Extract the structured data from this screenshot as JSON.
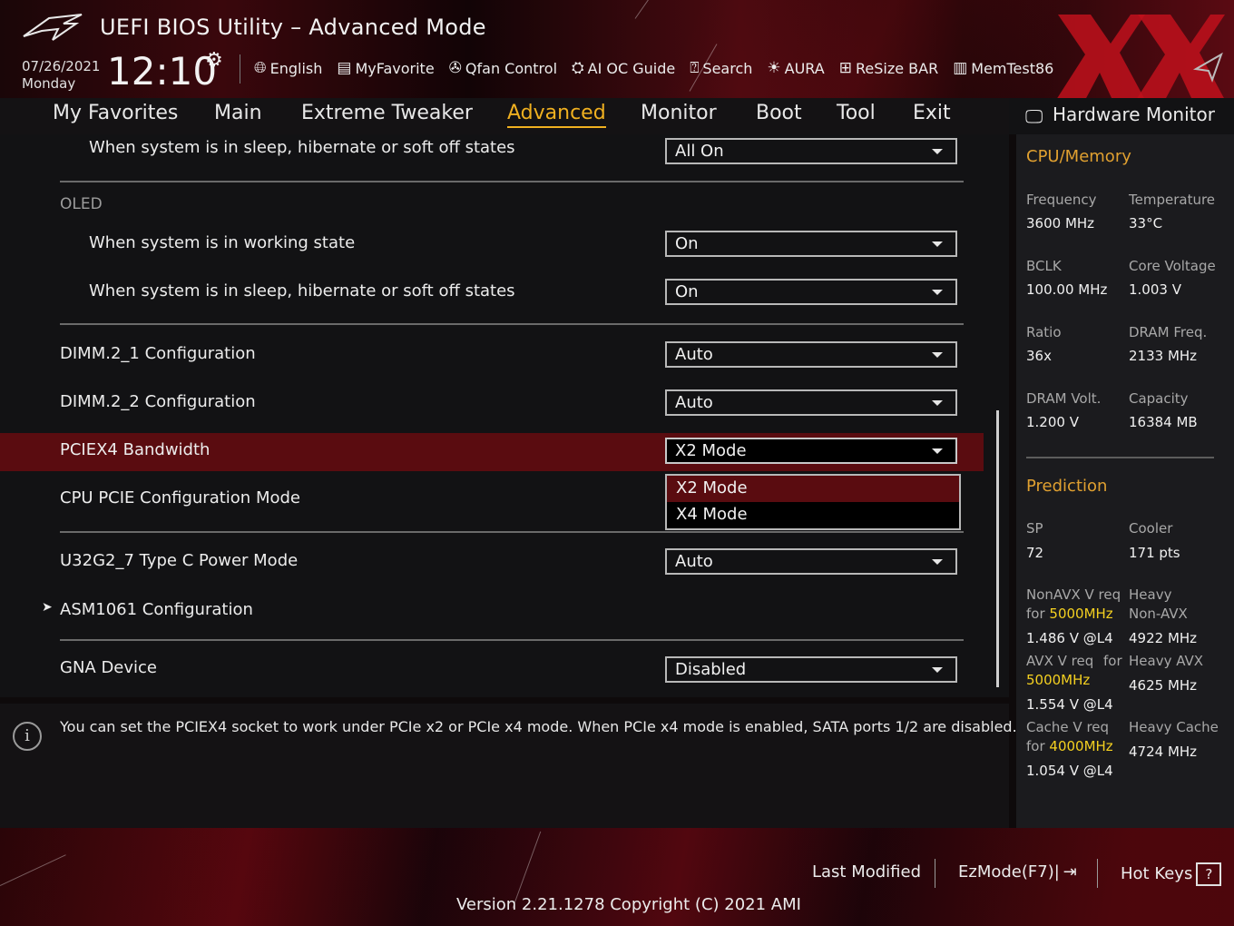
{
  "header": {
    "title": "UEFI BIOS Utility – Advanced Mode",
    "date": "07/26/2021",
    "day": "Monday",
    "time": "12:10"
  },
  "toolbar": [
    {
      "icon": "globe-icon",
      "label": "English"
    },
    {
      "icon": "favorite-icon",
      "label": "MyFavorite"
    },
    {
      "icon": "fan-icon",
      "label": "Qfan Control"
    },
    {
      "icon": "ai-chip-icon",
      "label": "AI OC Guide"
    },
    {
      "icon": "search-icon",
      "label": "Search"
    },
    {
      "icon": "aura-light-icon",
      "label": "AURA"
    },
    {
      "icon": "resize-bar-icon",
      "label": "ReSize BAR"
    },
    {
      "icon": "memory-icon",
      "label": "MemTest86"
    }
  ],
  "tabs": [
    "My Favorites",
    "Main",
    "Extreme Tweaker",
    "Advanced",
    "Monitor",
    "Boot",
    "Tool",
    "Exit"
  ],
  "active_tab": "Advanced",
  "settings": {
    "sleep_all": {
      "label": "When system is in sleep, hibernate or soft off states",
      "value": "All On"
    },
    "oled_section": "OLED",
    "oled_working": {
      "label": "When system is in working state",
      "value": "On"
    },
    "oled_sleep": {
      "label": "When system is in sleep, hibernate or soft off states",
      "value": "On"
    },
    "dimm21": {
      "label": "DIMM.2_1 Configuration",
      "value": "Auto"
    },
    "dimm22": {
      "label": "DIMM.2_2 Configuration",
      "value": "Auto"
    },
    "pciex4": {
      "label": "PCIEX4 Bandwidth",
      "value": "X2 Mode",
      "options": [
        "X2 Mode",
        "X4 Mode"
      ]
    },
    "cpu_pcie": {
      "label": "CPU PCIE Configuration Mode"
    },
    "u32g2": {
      "label": "U32G2_7 Type C Power Mode",
      "value": "Auto"
    },
    "asm1061": {
      "label": "ASM1061 Configuration",
      "arrow": "➤"
    },
    "gna": {
      "label": "GNA Device",
      "value": "Disabled"
    }
  },
  "info_text": "You can set the PCIEX4 socket to work under PCIe x2 or PCIe x4 mode. When PCIe x4 mode is enabled, SATA ports 1/2 are disabled.",
  "hw_monitor": {
    "title": "Hardware Monitor",
    "cpu_memory": {
      "heading": "CPU/Memory",
      "frequency_label": "Frequency",
      "frequency": "3600 MHz",
      "temperature_label": "Temperature",
      "temperature": "33°C",
      "bclk_label": "BCLK",
      "bclk": "100.00 MHz",
      "core_voltage_label": "Core Voltage",
      "core_voltage": "1.003 V",
      "ratio_label": "Ratio",
      "ratio": "36x",
      "dram_freq_label": "DRAM Freq.",
      "dram_freq": "2133 MHz",
      "dram_volt_label": "DRAM Volt.",
      "dram_volt": "1.200 V",
      "capacity_label": "Capacity",
      "capacity": "16384 MB"
    },
    "prediction": {
      "heading": "Prediction",
      "sp_label": "SP",
      "sp": "72",
      "cooler_label": "Cooler",
      "cooler": "171 pts",
      "nonavx_label": "NonAVX V req",
      "for_word": "for",
      "nonavx_freq": "5000MHz",
      "nonavx_v": "1.486 V @L4",
      "heavy_label": "Heavy",
      "nonavx_word": "Non-AVX",
      "heavy_nonavx": "4922 MHz",
      "avx_label": "AVX V req",
      "avx_for": "for",
      "avx_freq": "5000MHz",
      "avx_v": "1.554 V @L4",
      "heavy_avx_label": "Heavy AVX",
      "heavy_avx": "4625 MHz",
      "cache_label": "Cache V req",
      "cache_freq": "4000MHz",
      "cache_v": "1.054 V @L4",
      "heavy_cache_label": "Heavy Cache",
      "heavy_cache": "4724 MHz"
    }
  },
  "footer": {
    "last_modified": "Last Modified",
    "ezmode": "EzMode(F7)|",
    "hotkeys": "Hot Keys",
    "hotkeys_glyph": "?",
    "version": "Version 2.21.1278 Copyright (C) 2021 AMI"
  },
  "colors": {
    "accent": "#f0b020",
    "highlight": "#5a0c10",
    "brand_red": "#c0101c",
    "prediction_yellow": "#f4d020"
  }
}
